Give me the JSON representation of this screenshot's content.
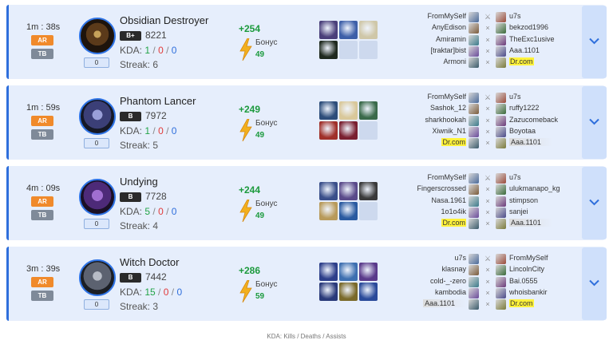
{
  "icons": {
    "chevron": "chevron-down-icon",
    "bolt": "lightning-bolt-icon",
    "versus": "crossed-swords-icon"
  },
  "colors": {
    "accent": "#2f6fdc",
    "win_green": "#1c9a3d",
    "deaths_red": "#e23a3a",
    "badge_ar": "#f08a2b",
    "badge_tb": "#7f8a99",
    "highlight_yellow": "#fff23a"
  },
  "matches": [
    {
      "time": "1m : 38s",
      "badge_ar": "AR",
      "badge_tb": "TB",
      "count": "0",
      "hero": "Obsidian Destroyer",
      "rank": "B+",
      "mmr": "8221",
      "kda_label": "KDA:",
      "kills": "1",
      "deaths": "0",
      "assists": "0",
      "streak": "Streak: 6",
      "mmr_change": "+254",
      "bonus_label": "Бонус",
      "bonus_value": "49",
      "players": [
        {
          "left": "FromMySelf",
          "right": "u7s"
        },
        {
          "left": "AnyEdison",
          "right": "bekzod1996"
        },
        {
          "left": "Amiramin",
          "right": "TheExc1usive"
        },
        {
          "left": "[traktar]bist",
          "right": "Aaa.1101"
        },
        {
          "left": "Armoni",
          "right": "Dr.com"
        }
      ]
    },
    {
      "time": "1m : 59s",
      "badge_ar": "AR",
      "badge_tb": "TB",
      "count": "0",
      "hero": "Phantom Lancer",
      "rank": "B",
      "mmr": "7972",
      "kda_label": "KDA:",
      "kills": "1",
      "deaths": "0",
      "assists": "0",
      "streak": "Streak: 5",
      "mmr_change": "+249",
      "bonus_label": "Бонус",
      "bonus_value": "49",
      "players": [
        {
          "left": "FromMySelf",
          "right": "u7s"
        },
        {
          "left": "Sashok_12",
          "right": "ruffy1222"
        },
        {
          "left": "sharkhookah",
          "right": "Zazucomeback"
        },
        {
          "left": "Xiwnik_N1",
          "right": "Boyotaa"
        },
        {
          "left": "Dr.com",
          "right": "Aaa.1101"
        }
      ]
    },
    {
      "time": "4m : 09s",
      "badge_ar": "AR",
      "badge_tb": "TB",
      "count": "0",
      "hero": "Undying",
      "rank": "B",
      "mmr": "7728",
      "kda_label": "KDA:",
      "kills": "5",
      "deaths": "0",
      "assists": "0",
      "streak": "Streak: 4",
      "mmr_change": "+244",
      "bonus_label": "Бонус",
      "bonus_value": "49",
      "players": [
        {
          "left": "FromMySelf",
          "right": "u7s"
        },
        {
          "left": "Fingerscrossed",
          "right": "ulukmanapo_kg"
        },
        {
          "left": "Nasa.1961",
          "right": "stimpson"
        },
        {
          "left": "1o1o4ik",
          "right": "sanjei"
        },
        {
          "left": "Dr.com",
          "right": "Aaa.1101"
        }
      ]
    },
    {
      "time": "3m : 39s",
      "badge_ar": "AR",
      "badge_tb": "TB",
      "count": "0",
      "hero": "Witch Doctor",
      "rank": "B",
      "mmr": "7442",
      "kda_label": "KDA:",
      "kills": "15",
      "deaths": "0",
      "assists": "0",
      "streak": "Streak: 3",
      "mmr_change": "+286",
      "bonus_label": "Бонус",
      "bonus_value": "59",
      "players": [
        {
          "left": "u7s",
          "right": "FromMySelf"
        },
        {
          "left": "klasnay",
          "right": "LincolnCity"
        },
        {
          "left": "cold-_-zero",
          "right": "Bai.0555"
        },
        {
          "left": "kambodia",
          "right": "whoisbankir"
        },
        {
          "left": "Aaa.1101",
          "right": "Dr.com"
        }
      ]
    }
  ],
  "footer": "KDA: Kills / Deaths / Assists"
}
